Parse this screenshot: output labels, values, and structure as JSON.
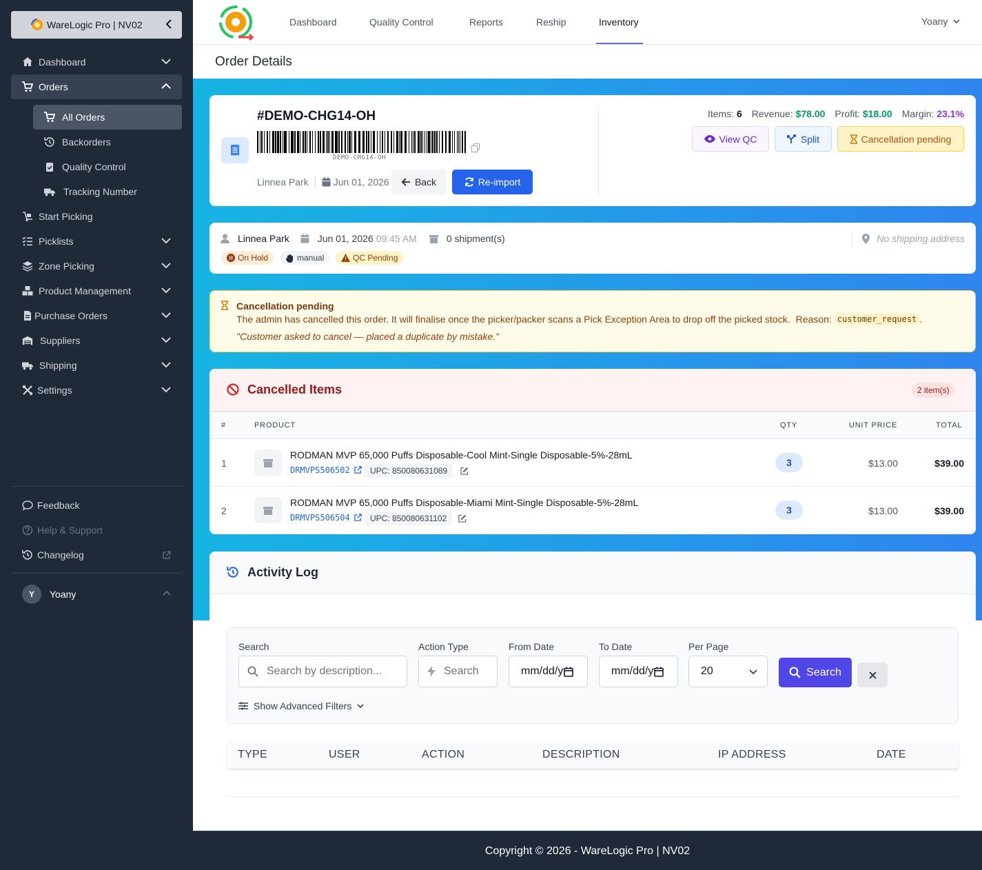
{
  "sidebar": {
    "brand": "WareLogic Pro | NV02",
    "menu": [
      {
        "label": "Dashboard"
      },
      {
        "label": "Orders"
      },
      {
        "label": "Start Picking"
      },
      {
        "label": "Picklists"
      },
      {
        "label": "Zone Picking"
      },
      {
        "label": "Product Management"
      },
      {
        "label": "Purchase Orders"
      },
      {
        "label": "Suppliers"
      },
      {
        "label": "Shipping"
      },
      {
        "label": "Settings"
      }
    ],
    "orders_submenu": [
      {
        "label": "All Orders"
      },
      {
        "label": "Backorders"
      },
      {
        "label": "Quality Control"
      },
      {
        "label": "Tracking Number"
      }
    ],
    "bottom": [
      {
        "label": "Feedback"
      },
      {
        "label": "Help & Support"
      },
      {
        "label": "Changelog"
      }
    ],
    "user": {
      "initial": "Y",
      "name": "Yoany"
    }
  },
  "topnav": {
    "items": [
      "Dashboard",
      "Quality Control",
      "Reports",
      "Reship",
      "Inventory"
    ],
    "active": "Inventory",
    "user": "Yoany"
  },
  "page": {
    "title": "Order Details"
  },
  "order": {
    "number": "#DEMO-CHG14-OH",
    "barcode_text": "DEMO-CHG14-OH",
    "customer": "Linnea Park",
    "date": "Jun 01, 2026",
    "back_label": "Back",
    "reimport_label": "Re-import",
    "stats": {
      "items_label": "Items:",
      "items": "6",
      "revenue_label": "Revenue:",
      "revenue": "$78.00",
      "profit_label": "Profit:",
      "profit": "$18.00",
      "margin_label": "Margin:",
      "margin": "23.1%"
    },
    "actions": {
      "view_qc": "View QC",
      "split": "Split",
      "cancellation": "Cancellation pending"
    }
  },
  "customer_card": {
    "name": "Linnea Park",
    "date": "Jun 01, 2026",
    "time": "09:45 AM",
    "shipments": "0 shipment(s)",
    "address": "No shipping address",
    "badges": {
      "on_hold": "On Hold",
      "manual": "manual",
      "qc_pending": "QC Pending"
    }
  },
  "alert": {
    "title": "Cancellation pending",
    "message": "The admin has cancelled this order. It will finalise once the picker/packer scans a Pick Exception Area to drop off the picked stock.",
    "reason_label": "Reason:",
    "reason_code": "customer_request",
    "quote": "\"Customer asked to cancel — placed a duplicate by mistake.\""
  },
  "cancelled_items": {
    "title": "Cancelled Items",
    "count": "2 item(s)",
    "headers": {
      "num": "#",
      "product": "PRODUCT",
      "qty": "QTY",
      "unit_price": "UNIT PRICE",
      "total": "TOTAL"
    },
    "upc_label": "UPC:",
    "rows": [
      {
        "num": "1",
        "name": "RODMAN MVP 65,000 Puffs Disposable-Cool Mint-Single Disposable-5%-28mL",
        "sku": "DRMVPS506502",
        "upc": "850080631089",
        "qty": "3",
        "unit_price": "$13.00",
        "total": "$39.00"
      },
      {
        "num": "2",
        "name": "RODMAN MVP 65,000 Puffs Disposable-Miami Mint-Single Disposable-5%-28mL",
        "sku": "DRMVPS506504",
        "upc": "850080631102",
        "qty": "3",
        "unit_price": "$13.00",
        "total": "$39.00"
      }
    ]
  },
  "activity": {
    "title": "Activity Log",
    "filters": {
      "search_label": "Search",
      "search_placeholder": "Search by description...",
      "action_label": "Action Type",
      "action_placeholder": "Search",
      "from_label": "From Date",
      "from_value": "mm/dd/yyyy",
      "to_label": "To Date",
      "to_value": "mm/dd/yyyy",
      "per_page_label": "Per Page",
      "per_page_value": "20",
      "search_button": "Search",
      "advanced": "Show Advanced Filters"
    },
    "columns": [
      "TYPE",
      "USER",
      "ACTION",
      "DESCRIPTION",
      "IP ADDRESS",
      "DATE"
    ]
  },
  "footer": {
    "text": "Copyright © 2026 - WareLogic Pro | NV02"
  },
  "colors": {
    "primary": "#2563eb",
    "indigo": "#4f46e5",
    "green": "#059669",
    "purple": "#9333ea",
    "danger": "#dc2626",
    "warning": "#b45309"
  }
}
